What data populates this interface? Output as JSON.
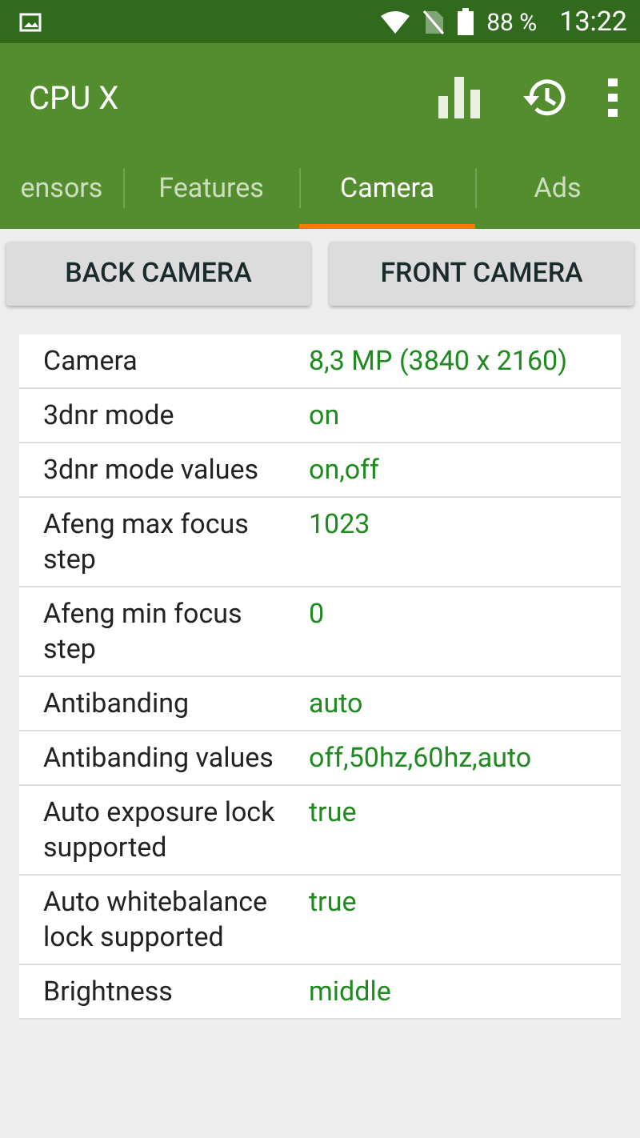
{
  "status_bar": {
    "battery": "88 %",
    "time": "13:22"
  },
  "app_bar": {
    "title": "CPU X"
  },
  "tabs": [
    {
      "label": "ensors",
      "selected": false
    },
    {
      "label": "Features",
      "selected": false
    },
    {
      "label": "Camera",
      "selected": true
    },
    {
      "label": "Ads",
      "selected": false
    }
  ],
  "buttons": [
    "BACK CAMERA",
    "FRONT CAMERA"
  ],
  "rows": [
    {
      "name": "Camera",
      "value": "8,3 MP (3840 x 2160)"
    },
    {
      "name": "3dnr mode",
      "value": "on"
    },
    {
      "name": "3dnr mode values",
      "value": "on,off"
    },
    {
      "name": "Afeng max focus step",
      "value": "1023"
    },
    {
      "name": "Afeng min focus step",
      "value": "0"
    },
    {
      "name": "Antibanding",
      "value": "auto"
    },
    {
      "name": "Antibanding values",
      "value": "off,50hz,60hz,auto"
    },
    {
      "name": "Auto exposure lock supported",
      "value": "true"
    },
    {
      "name": "Auto whitebalance lock supported",
      "value": "true"
    },
    {
      "name": "Brightness",
      "value": "middle"
    }
  ]
}
